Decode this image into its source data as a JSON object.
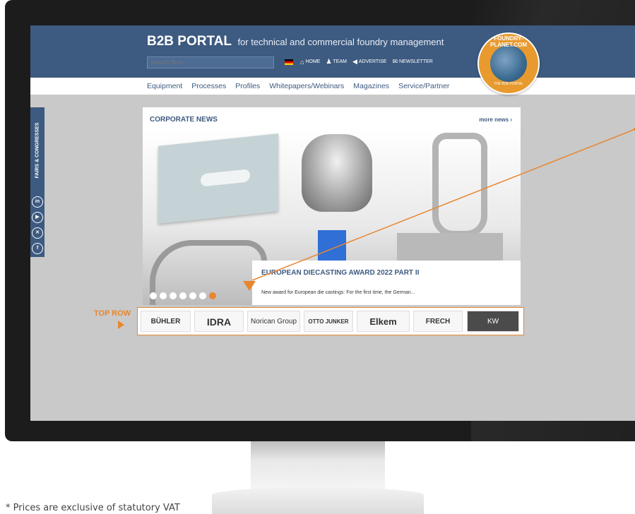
{
  "header": {
    "brand_title": "B2B PORTAL",
    "brand_sub": "for technical and commercial foundry management",
    "search_placeholder": "Search Term",
    "topnav": [
      "HOME",
      "TEAM",
      "ADVERTISE",
      "NEWSLETTER"
    ]
  },
  "mainnav": [
    "Equipment",
    "Processes",
    "Profiles",
    "Whitepapers/Webinars",
    "Magazines",
    "Service/Partner"
  ],
  "badge": {
    "text": "FOUNDRY-PLANET.COM",
    "sub": "THE B2B PORTAL"
  },
  "sidebar": {
    "fairs_label": "FAIRS & CONGRESSES",
    "social": [
      "in",
      "yt",
      "xing",
      "f"
    ]
  },
  "news": {
    "title": "CORPORATE NEWS",
    "more": "more news ›",
    "caption_title": "EUROPEAN DIECASTING AWARD 2022 PART II",
    "caption_text": "New award for European die castings: For the first time, the German...",
    "slides_total": 7,
    "active_slide_index": 6
  },
  "toprow": {
    "label": "TOP ROW",
    "logos": [
      "BÜHLER",
      "IDRA",
      "Norican Group",
      "OTTO JUNKER",
      "Elkem",
      "FRECH",
      "KW"
    ]
  },
  "footnote": "* Prices are exclusive of statutory VAT",
  "colors": {
    "brand_blue": "#3d5a80",
    "accent_orange": "#e8862e"
  }
}
